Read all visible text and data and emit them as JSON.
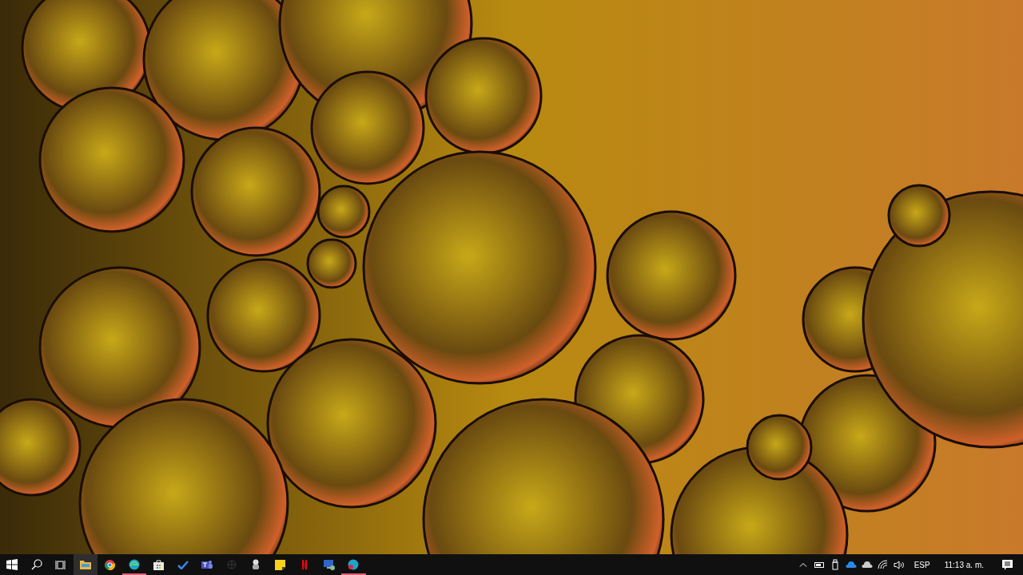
{
  "taskbar": {
    "apps": [
      {
        "kind": "start",
        "running": false,
        "hovered": false
      },
      {
        "kind": "search",
        "running": false,
        "hovered": false
      },
      {
        "kind": "taskview",
        "running": false,
        "hovered": false
      },
      {
        "kind": "folder",
        "running": false,
        "hovered": true
      },
      {
        "kind": "chrome",
        "running": false,
        "hovered": false
      },
      {
        "kind": "edge",
        "running": true,
        "hovered": false
      },
      {
        "kind": "bag",
        "running": false,
        "hovered": false
      },
      {
        "kind": "check",
        "running": false,
        "hovered": false
      },
      {
        "kind": "teams",
        "running": false,
        "hovered": false
      },
      {
        "kind": "globe",
        "running": false,
        "hovered": false
      },
      {
        "kind": "figure",
        "running": false,
        "hovered": false
      },
      {
        "kind": "note",
        "running": false,
        "hovered": false
      },
      {
        "kind": "netflix",
        "running": false,
        "hovered": false
      },
      {
        "kind": "monitor",
        "running": false,
        "hovered": false
      },
      {
        "kind": "edgedev",
        "running": true,
        "hovered": false
      }
    ],
    "tray": [
      {
        "kind": "chevron"
      },
      {
        "kind": "battery"
      },
      {
        "kind": "usb"
      },
      {
        "kind": "onedrive"
      },
      {
        "kind": "cloud"
      },
      {
        "kind": "wifi"
      },
      {
        "kind": "volume"
      }
    ],
    "language": "ESP",
    "clock": "11:13 a. m."
  }
}
